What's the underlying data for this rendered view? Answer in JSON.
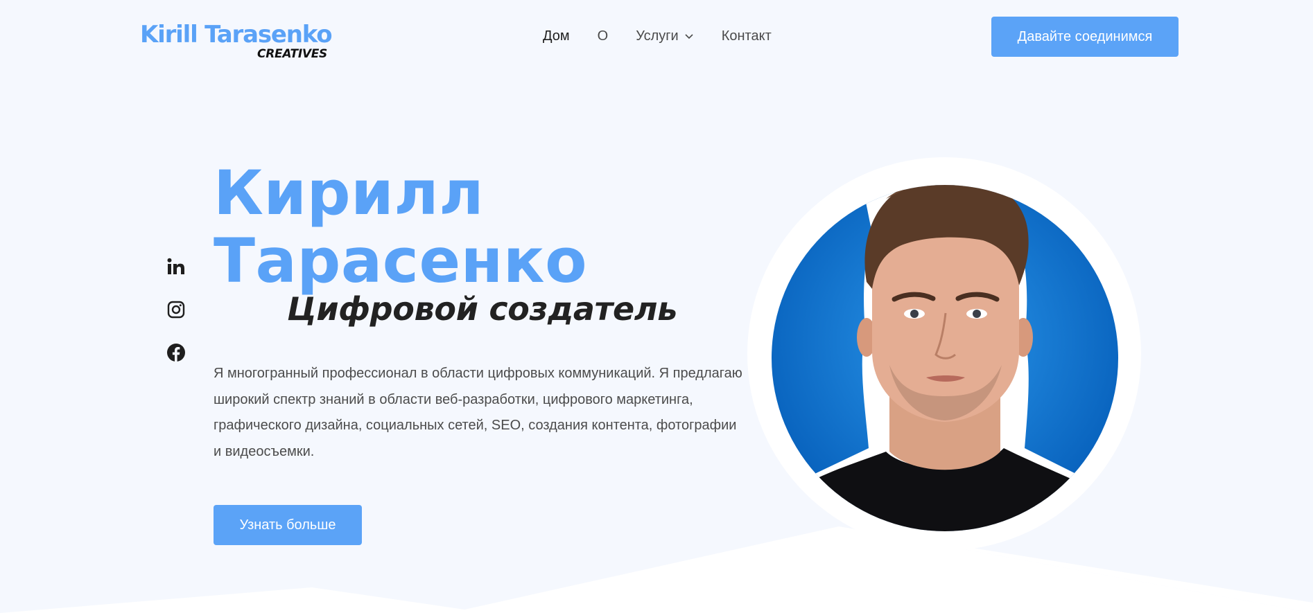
{
  "header": {
    "logo": {
      "main": "Kirill Tarasenko",
      "sub": "CREATIVES"
    },
    "nav": [
      {
        "label": "Дом",
        "active": true
      },
      {
        "label": "О"
      },
      {
        "label": "Услуги",
        "has_dropdown": true
      },
      {
        "label": "Контакт"
      }
    ],
    "cta_label": "Давайте соединимся"
  },
  "social": [
    {
      "icon": "linkedin-icon"
    },
    {
      "icon": "instagram-icon"
    },
    {
      "icon": "facebook-icon"
    }
  ],
  "hero": {
    "name_line1": "Кирилл",
    "name_line2": "Тарасенко",
    "role": "Цифровой создатель",
    "description": "Я многогранный профессионал в области цифровых коммуникаций. Я предлагаю широкий спектр знаний в области веб-разработки,  цифрового маркетинга, графического дизайна, социальных сетей, SEO, создания контента, фотографии и видеосъемки.",
    "cta_label": "Узнать больше"
  },
  "colors": {
    "accent": "#5ba3f7",
    "page_bg": "#f5f8fe",
    "dark_text": "#222222",
    "portrait_bg_blue": "#0a74d1"
  }
}
